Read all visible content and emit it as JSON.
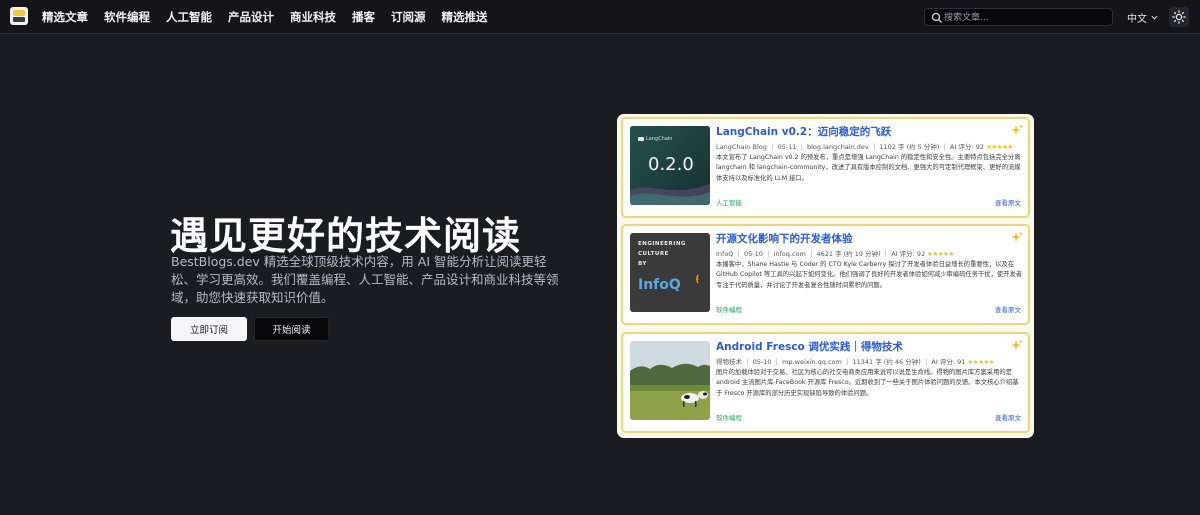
{
  "nav": {
    "items": [
      {
        "label": "精选文章"
      },
      {
        "label": "软件编程"
      },
      {
        "label": "人工智能"
      },
      {
        "label": "产品设计"
      },
      {
        "label": "商业科技"
      },
      {
        "label": "播客"
      },
      {
        "label": "订阅源"
      },
      {
        "label": "精选推送"
      }
    ],
    "search_placeholder": "搜索文章...",
    "language": "中文"
  },
  "hero": {
    "title": "遇见更好的技术阅读",
    "description": "BestBlogs.dev 精选全球顶级技术内容，用 AI 智能分析让阅读更轻松、学习更高效。我们覆盖编程、人工智能、产品设计和商业科技等领域，助您快速获取知识价值。",
    "subscribe_button": "立即订阅",
    "read_button": "开始阅读"
  },
  "cards": [
    {
      "title": "LangChain v0.2：迈向稳定的飞跃",
      "meta": "LangChain Blog ｜ 05-11 ｜ blog.langchain.dev ｜ 1102 字 (约 5 分钟) ｜ AI 评分: 92 ",
      "stars": "★★★★★",
      "summary": "本文宣布了 LangChain v0.2 的预发布，重点是增强 LangChain 的稳定性和安全性。主要特点包括完全分离 langchain 和 langchain-community，改进了具有版本控制的文档、更强大的可定制代理框架、更好的流媒体支持以及标准化的 LLM 接口。",
      "tag": "人工智能",
      "link": "查看原文",
      "thumb_text": "0.2.0",
      "thumb_brand": "LangChain"
    },
    {
      "title": "开源文化影响下的开发者体验",
      "meta": "InfoQ ｜ 05-10 ｜ infoq.com ｜ 4621 字 (约 19 分钟) ｜ AI 评分: 92 ",
      "stars": "★★★★★",
      "summary": "本播客中，Shane Hastie 与 Coder 的 CTO Kyle Carberry 探讨了开发者体验日益增长的重要性，以及在 GitHub Copilot 等工具的兴起下如何变化。他们强调了良好的开发者体验如何减少审编码任务干扰，使开发者专注于代码质量，并讨论了开发者复合性随时间累积的问题。",
      "tag": "软件编程",
      "link": "查看原文",
      "thumb_lines": [
        "ENGINEERING",
        "CULTURE",
        "BY"
      ],
      "thumb_brand": "InfoQ"
    },
    {
      "title": "Android Fresco 调优实践｜得物技术",
      "meta": "得物技术 ｜ 05-10 ｜ mp.weixin.qq.com ｜ 11341 字 (约 46 分钟) ｜ AI 评分: 91 ",
      "stars": "★★★★★",
      "summary": "图片的加载体验对于交易、社区为核心的社交电商类应用来说可以说是生命线。得物的图片库方案采用的是 android 主流图片库-FaceBook 开源库 Fresco。近期收到了一些关于图片体验问题的反馈。本文核心介绍基于 Fresco 开源库的部分历史实现缺陷导致的体验问题。",
      "tag": "软件编程",
      "link": "查看原文"
    }
  ]
}
